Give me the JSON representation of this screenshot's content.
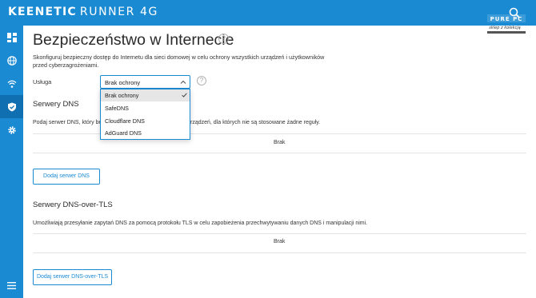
{
  "header": {
    "brand": "KEENETIC",
    "model": "RUNNER 4G",
    "watermark_lines": [
      "PURE PC",
      "sklep z kolekcją"
    ]
  },
  "sidebar": {
    "items": [
      {
        "icon": "dashboard-icon",
        "active": false
      },
      {
        "icon": "globe-icon",
        "active": false
      },
      {
        "icon": "wifi-icon",
        "active": false
      },
      {
        "icon": "shield-icon",
        "active": true
      },
      {
        "icon": "gear-icon",
        "active": false
      }
    ],
    "menu_icon": "hamburger-menu-icon"
  },
  "page": {
    "title": "Bezpieczeństwo w Internecie",
    "title_help": "?",
    "description": "Skonfiguruj bezpieczny dostęp do Internetu dla sieci domowej w celu ochrony wszystkich urządzeń i użytkowników przed cyberzagrożeniami."
  },
  "service": {
    "label": "Usługa",
    "value": "Brak ochrony",
    "help": "?",
    "options": [
      {
        "label": "Brak ochrony",
        "selected": true
      },
      {
        "label": "SafeDNS",
        "selected": false
      },
      {
        "label": "Cloudflare DNS",
        "selected": false
      },
      {
        "label": "AdGuard DNS",
        "selected": false
      }
    ]
  },
  "dns_servers": {
    "title": "Serwery DNS",
    "desc_start": "Podaj serwer DNS, który będ",
    "desc_end": "rządzeń, dla których nie są stosowane żadne reguły.",
    "empty": "Brak",
    "add_button": "Dodaj serwer DNS"
  },
  "dns_tls": {
    "title": "Serwery DNS-over-TLS",
    "desc": "Umożliwiają przesyłanie zapytań DNS za pomocą protokołu TLS w celu zapobieżenia przechwytywaniu danych DNS i manipulacji nimi.",
    "empty": "Brak",
    "add_button": "Dodaj serwer DNS-over-TLS"
  },
  "colors": {
    "accent": "#1a8ad3",
    "sidebar_active": "#0f6fb0",
    "option_selected": "#e6e6e6"
  }
}
